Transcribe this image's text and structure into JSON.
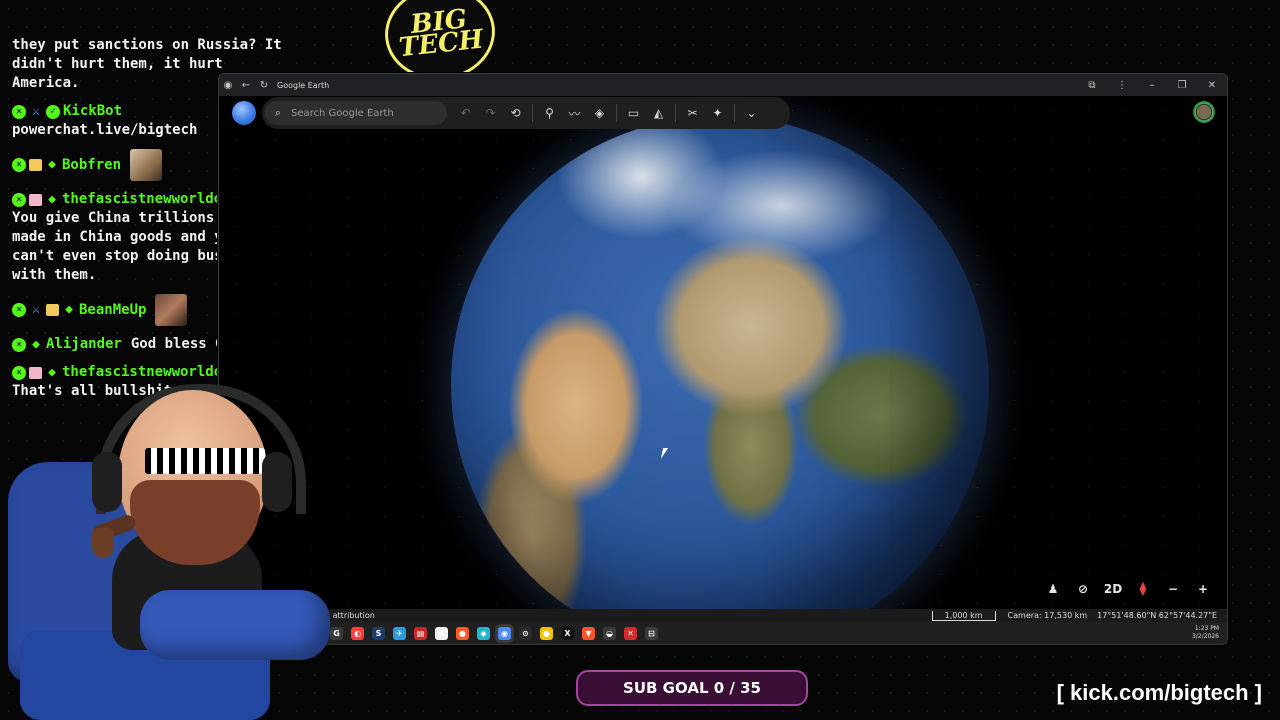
{
  "chat": {
    "top_line": "they put sanctions on Russia? It didn't hurt them, it hurt America.",
    "messages": [
      {
        "user": "KickBot",
        "text": "powerchat.live/bigtech"
      },
      {
        "user": "Bobfren",
        "text": ""
      },
      {
        "user": "thefascistnewworldorder",
        "text": "You give China trillions buying made in China goods and you can't even stop doing business with them."
      },
      {
        "user": "BeanMeUp",
        "text": ""
      },
      {
        "user": "Alijander",
        "text": "God bless God"
      },
      {
        "user": "thefascistnewworldorder",
        "text": "That's all bullshit."
      }
    ]
  },
  "logo": {
    "text": "BIG TECH"
  },
  "window": {
    "tab_title": "Google Earth",
    "search_placeholder": "Search Google Earth",
    "icons": {
      "undo": "↶",
      "redo": "↷",
      "history": "⟲",
      "pin": "⚲",
      "path": "〰",
      "layers": "◈",
      "ruler": "▭",
      "photo": "◭",
      "tools": "✂",
      "gemini": "✦",
      "more": "⌄"
    },
    "status": {
      "attribution": "Data attribution",
      "scale": "1,000 km",
      "camera": "Camera: 17,530 km",
      "coords": "17°51'48.60\"N 62°57'44.27\"E"
    },
    "controls": {
      "view_2d": "2D"
    },
    "clock": {
      "time": "1:23 PM",
      "date": "3/2/2026"
    }
  },
  "taskbar": [
    {
      "glyph": "▭",
      "color": "#e0b400"
    },
    {
      "glyph": "G",
      "color": "#3a3a3a"
    },
    {
      "glyph": "◐",
      "color": "#ff3d3d"
    },
    {
      "glyph": "S",
      "color": "#1c3b6e"
    },
    {
      "glyph": "✈",
      "color": "#2f9bdc"
    },
    {
      "glyph": "▤",
      "color": "#c82a2a"
    },
    {
      "glyph": "A",
      "color": "#f1f1f1"
    },
    {
      "glyph": "●",
      "color": "#ff5a2a"
    },
    {
      "glyph": "◆",
      "color": "#20b8c9"
    },
    {
      "glyph": "◉",
      "color": "#4d8df5"
    },
    {
      "glyph": "⊙",
      "color": "#2a2a2a"
    },
    {
      "glyph": "●",
      "color": "#f0c400"
    },
    {
      "glyph": "X",
      "color": "#111"
    },
    {
      "glyph": "▼",
      "color": "#fb542b"
    },
    {
      "glyph": "◒",
      "color": "#3a3a3a"
    },
    {
      "glyph": "✕",
      "color": "#d02c2c"
    },
    {
      "glyph": "⊟",
      "color": "#3a3a3a"
    }
  ],
  "subgoal": "SUB GOAL 0 / 35",
  "url": "[ kick.com/bigtech ]"
}
